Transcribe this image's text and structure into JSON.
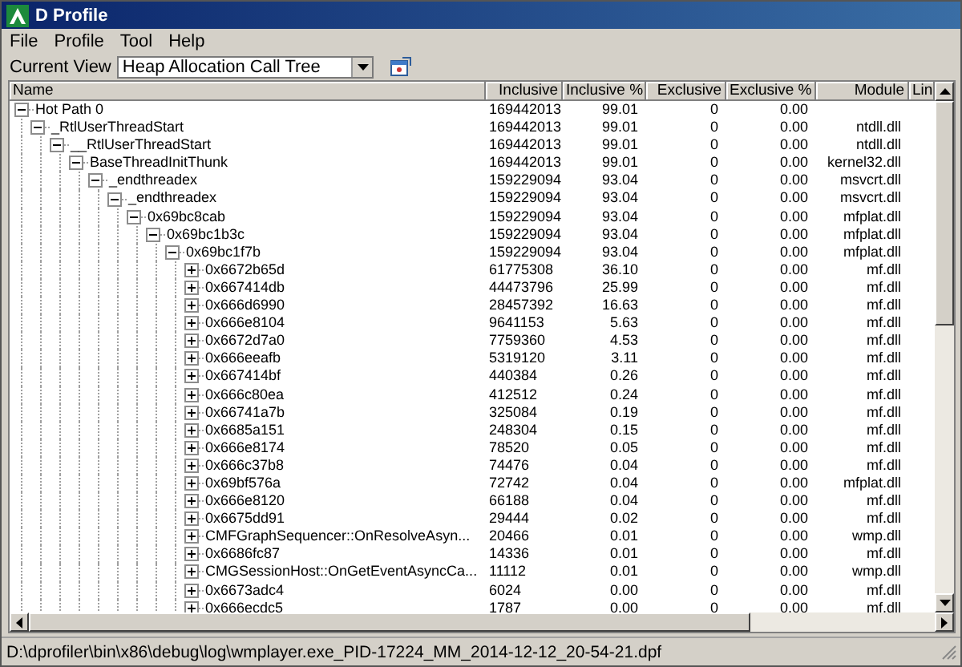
{
  "window": {
    "title": "D Profile"
  },
  "menu": [
    "File",
    "Profile",
    "Tool",
    "Help"
  ],
  "toolbar": {
    "label": "Current View",
    "view": "Heap Allocation Call Tree"
  },
  "columns": [
    "Name",
    "Inclusive",
    "Inclusive %",
    "Exclusive",
    "Exclusive %",
    "Module",
    "Lin"
  ],
  "rows": [
    {
      "name": "Hot Path 0",
      "inclusive": "169442013",
      "inclusive_pct": "99.01",
      "exclusive": "0",
      "exclusive_pct": "0.00",
      "expanded": true,
      "children": [
        {
          "name": "_RtlUserThreadStart",
          "inclusive": "169442013",
          "inclusive_pct": "99.01",
          "exclusive": "0",
          "exclusive_pct": "0.00",
          "module": "ntdll.dll",
          "expanded": true,
          "children": [
            {
              "name": "__RtlUserThreadStart",
              "inclusive": "169442013",
              "inclusive_pct": "99.01",
              "exclusive": "0",
              "exclusive_pct": "0.00",
              "module": "ntdll.dll",
              "expanded": true,
              "children": [
                {
                  "name": "BaseThreadInitThunk",
                  "inclusive": "169442013",
                  "inclusive_pct": "99.01",
                  "exclusive": "0",
                  "exclusive_pct": "0.00",
                  "module": "kernel32.dll",
                  "expanded": true,
                  "children": [
                    {
                      "name": "_endthreadex",
                      "inclusive": "159229094",
                      "inclusive_pct": "93.04",
                      "exclusive": "0",
                      "exclusive_pct": "0.00",
                      "module": "msvcrt.dll",
                      "expanded": true,
                      "children": [
                        {
                          "name": "_endthreadex",
                          "inclusive": "159229094",
                          "inclusive_pct": "93.04",
                          "exclusive": "0",
                          "exclusive_pct": "0.00",
                          "module": "msvcrt.dll",
                          "expanded": true,
                          "children": [
                            {
                              "name": "0x69bc8cab",
                              "inclusive": "159229094",
                              "inclusive_pct": "93.04",
                              "exclusive": "0",
                              "exclusive_pct": "0.00",
                              "module": "mfplat.dll",
                              "expanded": true,
                              "children": [
                                {
                                  "name": "0x69bc1b3c",
                                  "inclusive": "159229094",
                                  "inclusive_pct": "93.04",
                                  "exclusive": "0",
                                  "exclusive_pct": "0.00",
                                  "module": "mfplat.dll",
                                  "expanded": true,
                                  "children": [
                                    {
                                      "name": "0x69bc1f7b",
                                      "inclusive": "159229094",
                                      "inclusive_pct": "93.04",
                                      "exclusive": "0",
                                      "exclusive_pct": "0.00",
                                      "module": "mfplat.dll",
                                      "expanded": true,
                                      "children": [
                                        {
                                          "name": "0x6672b65d",
                                          "inclusive": "61775308",
                                          "inclusive_pct": "36.10",
                                          "exclusive": "0",
                                          "exclusive_pct": "0.00",
                                          "module": "mf.dll",
                                          "expanded": false
                                        },
                                        {
                                          "name": "0x667414db",
                                          "inclusive": "44473796",
                                          "inclusive_pct": "25.99",
                                          "exclusive": "0",
                                          "exclusive_pct": "0.00",
                                          "module": "mf.dll",
                                          "expanded": false
                                        },
                                        {
                                          "name": "0x666d6990",
                                          "inclusive": "28457392",
                                          "inclusive_pct": "16.63",
                                          "exclusive": "0",
                                          "exclusive_pct": "0.00",
                                          "module": "mf.dll",
                                          "expanded": false
                                        },
                                        {
                                          "name": "0x666e8104",
                                          "inclusive": "9641153",
                                          "inclusive_pct": "5.63",
                                          "exclusive": "0",
                                          "exclusive_pct": "0.00",
                                          "module": "mf.dll",
                                          "expanded": false
                                        },
                                        {
                                          "name": "0x6672d7a0",
                                          "inclusive": "7759360",
                                          "inclusive_pct": "4.53",
                                          "exclusive": "0",
                                          "exclusive_pct": "0.00",
                                          "module": "mf.dll",
                                          "expanded": false
                                        },
                                        {
                                          "name": "0x666eeafb",
                                          "inclusive": "5319120",
                                          "inclusive_pct": "3.11",
                                          "exclusive": "0",
                                          "exclusive_pct": "0.00",
                                          "module": "mf.dll",
                                          "expanded": false
                                        },
                                        {
                                          "name": "0x667414bf",
                                          "inclusive": "440384",
                                          "inclusive_pct": "0.26",
                                          "exclusive": "0",
                                          "exclusive_pct": "0.00",
                                          "module": "mf.dll",
                                          "expanded": false
                                        },
                                        {
                                          "name": "0x666c80ea",
                                          "inclusive": "412512",
                                          "inclusive_pct": "0.24",
                                          "exclusive": "0",
                                          "exclusive_pct": "0.00",
                                          "module": "mf.dll",
                                          "expanded": false
                                        },
                                        {
                                          "name": "0x66741a7b",
                                          "inclusive": "325084",
                                          "inclusive_pct": "0.19",
                                          "exclusive": "0",
                                          "exclusive_pct": "0.00",
                                          "module": "mf.dll",
                                          "expanded": false
                                        },
                                        {
                                          "name": "0x6685a151",
                                          "inclusive": "248304",
                                          "inclusive_pct": "0.15",
                                          "exclusive": "0",
                                          "exclusive_pct": "0.00",
                                          "module": "mf.dll",
                                          "expanded": false
                                        },
                                        {
                                          "name": "0x666e8174",
                                          "inclusive": "78520",
                                          "inclusive_pct": "0.05",
                                          "exclusive": "0",
                                          "exclusive_pct": "0.00",
                                          "module": "mf.dll",
                                          "expanded": false
                                        },
                                        {
                                          "name": "0x666c37b8",
                                          "inclusive": "74476",
                                          "inclusive_pct": "0.04",
                                          "exclusive": "0",
                                          "exclusive_pct": "0.00",
                                          "module": "mf.dll",
                                          "expanded": false
                                        },
                                        {
                                          "name": "0x69bf576a",
                                          "inclusive": "72742",
                                          "inclusive_pct": "0.04",
                                          "exclusive": "0",
                                          "exclusive_pct": "0.00",
                                          "module": "mfplat.dll",
                                          "expanded": false
                                        },
                                        {
                                          "name": "0x666e8120",
                                          "inclusive": "66188",
                                          "inclusive_pct": "0.04",
                                          "exclusive": "0",
                                          "exclusive_pct": "0.00",
                                          "module": "mf.dll",
                                          "expanded": false
                                        },
                                        {
                                          "name": "0x6675dd91",
                                          "inclusive": "29444",
                                          "inclusive_pct": "0.02",
                                          "exclusive": "0",
                                          "exclusive_pct": "0.00",
                                          "module": "mf.dll",
                                          "expanded": false
                                        },
                                        {
                                          "name": "CMFGraphSequencer::OnResolveAsyn...",
                                          "inclusive": "20466",
                                          "inclusive_pct": "0.01",
                                          "exclusive": "0",
                                          "exclusive_pct": "0.00",
                                          "module": "wmp.dll",
                                          "expanded": false
                                        },
                                        {
                                          "name": "0x6686fc87",
                                          "inclusive": "14336",
                                          "inclusive_pct": "0.01",
                                          "exclusive": "0",
                                          "exclusive_pct": "0.00",
                                          "module": "mf.dll",
                                          "expanded": false
                                        },
                                        {
                                          "name": "CMGSessionHost::OnGetEventAsyncCa...",
                                          "inclusive": "11112",
                                          "inclusive_pct": "0.01",
                                          "exclusive": "0",
                                          "exclusive_pct": "0.00",
                                          "module": "wmp.dll",
                                          "expanded": false
                                        },
                                        {
                                          "name": "0x6673adc4",
                                          "inclusive": "6024",
                                          "inclusive_pct": "0.00",
                                          "exclusive": "0",
                                          "exclusive_pct": "0.00",
                                          "module": "mf.dll",
                                          "expanded": false
                                        },
                                        {
                                          "name": "0x666ecdc5",
                                          "inclusive": "1787",
                                          "inclusive_pct": "0.00",
                                          "exclusive": "0",
                                          "exclusive_pct": "0.00",
                                          "module": "mf.dll",
                                          "expanded": false
                                        }
                                      ]
                                    }
                                  ]
                                }
                              ]
                            }
                          ]
                        }
                      ]
                    }
                  ]
                }
              ]
            }
          ]
        }
      ]
    }
  ],
  "status_bar": "D:\\dprofiler\\bin\\x86\\debug\\log\\wmplayer.exe_PID-17224_MM_2014-12-12_20-54-21.dpf"
}
